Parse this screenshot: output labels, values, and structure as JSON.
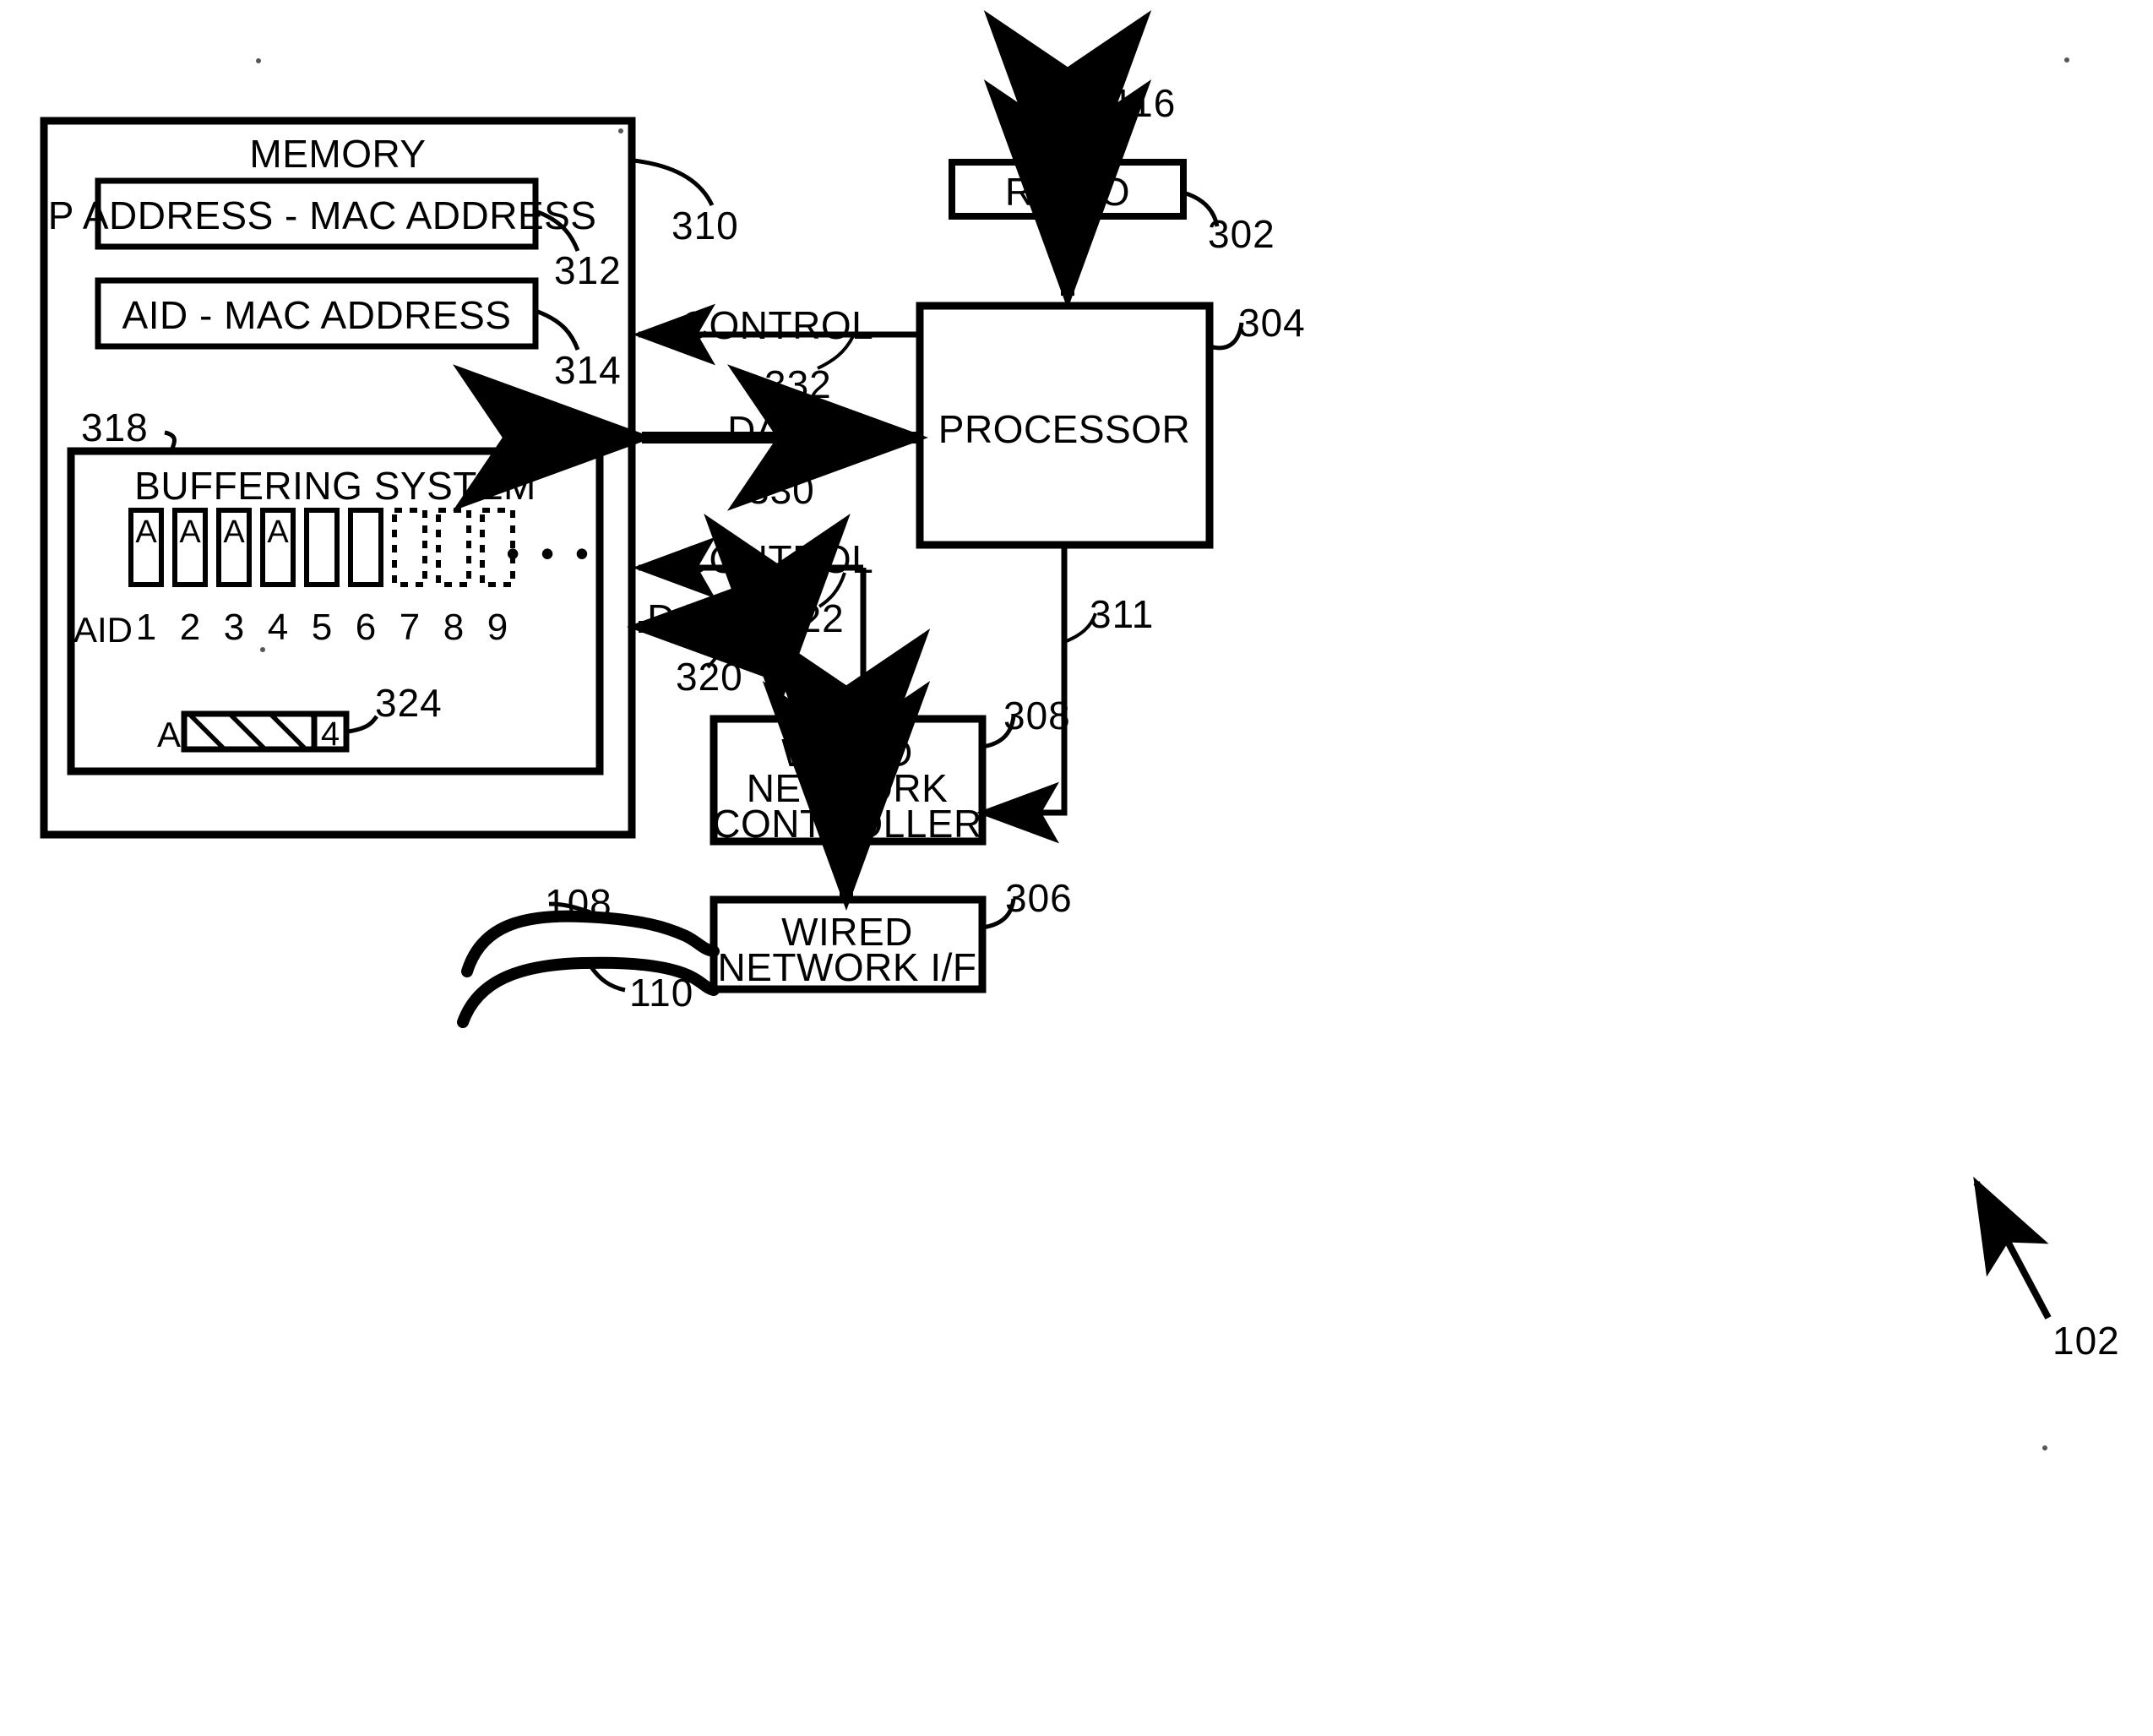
{
  "figure": {
    "type": "patent-block-diagram",
    "overall_ref": "102"
  },
  "memory": {
    "title": "MEMORY",
    "ref": "310",
    "tables": [
      {
        "label": "IP ADDRESS - MAC ADDRESS",
        "ref": "312"
      },
      {
        "label": "AID - MAC ADDRESS",
        "ref": "314"
      }
    ],
    "buffering_system": {
      "title": "BUFFERING SYSTEM",
      "ref": "318",
      "aid_label": "AID",
      "ellipsis": "• • •",
      "slots": [
        {
          "index": "1",
          "content": "A",
          "style": "solid"
        },
        {
          "index": "2",
          "content": "A",
          "style": "solid"
        },
        {
          "index": "3",
          "content": "A",
          "style": "solid"
        },
        {
          "index": "4",
          "content": "A",
          "style": "solid"
        },
        {
          "index": "5",
          "content": "",
          "style": "solid"
        },
        {
          "index": "6",
          "content": "",
          "style": "solid"
        },
        {
          "index": "7",
          "content": "",
          "style": "dashed"
        },
        {
          "index": "8",
          "content": "",
          "style": "dashed"
        },
        {
          "index": "9",
          "content": "",
          "style": "dashed"
        }
      ],
      "frame": {
        "ref": "324",
        "prefix": "A",
        "payload_fill": "hatched",
        "aid_value": "4"
      }
    }
  },
  "radio": {
    "label": "RADIO",
    "ref": "302",
    "antenna_ref": "116"
  },
  "processor": {
    "label": "PROCESSOR",
    "ref": "304"
  },
  "wired_network_controller": {
    "label_line1": "WIRED",
    "label_line2": "NETWORK",
    "label_line3": "CONTROLLER",
    "ref": "308"
  },
  "wired_network_if": {
    "label_line1": "WIRED",
    "label_line2": "NETWORK I/F",
    "ref": "306"
  },
  "cables": [
    {
      "ref": "108"
    },
    {
      "ref": "110"
    }
  ],
  "buses": [
    {
      "name": "memory-processor-control",
      "label": "CONTROL",
      "ref": "332",
      "direction": "left"
    },
    {
      "name": "memory-processor-data",
      "label": "DATA",
      "ref": "330",
      "direction": "both"
    },
    {
      "name": "memory-wnc-control",
      "label": "CONTROL",
      "ref": "322",
      "direction": "left"
    },
    {
      "name": "memory-wnc-data",
      "label": "DATA",
      "ref": "320",
      "direction": "left-and-down"
    },
    {
      "name": "processor-wnc",
      "label": "",
      "ref": "311",
      "direction": "down-left"
    }
  ],
  "colors": {
    "ink": "#000000",
    "paper": "#ffffff"
  }
}
